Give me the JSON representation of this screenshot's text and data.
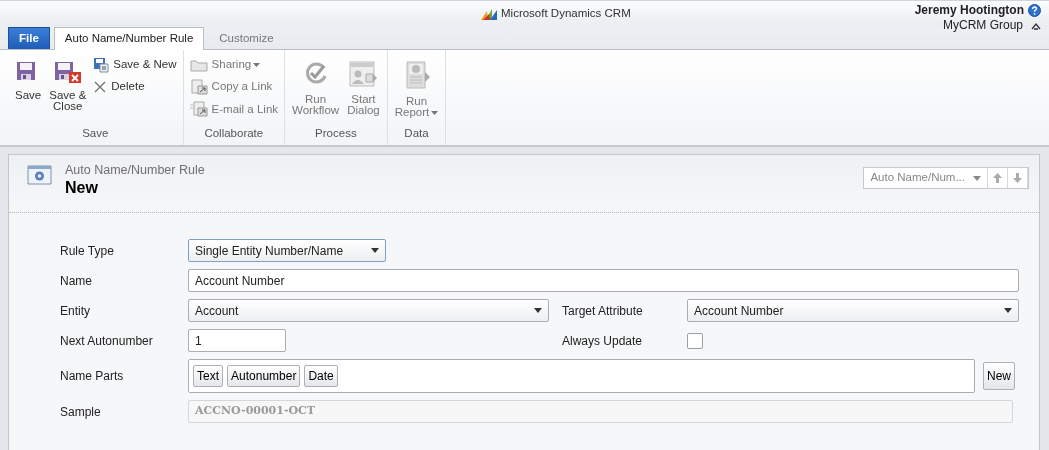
{
  "app": {
    "title": "Microsoft Dynamics CRM",
    "user": "Jeremy Hootington",
    "organization": "MyCRM Group"
  },
  "tabs": [
    {
      "label": "File",
      "kind": "file",
      "selected": false
    },
    {
      "label": "Auto Name/Number Rule",
      "kind": "tab",
      "selected": true
    },
    {
      "label": "Customize",
      "kind": "tab",
      "selected": false
    }
  ],
  "ribbon": [
    {
      "label": "Save",
      "items": [
        {
          "label": "Save",
          "kind": "large",
          "disabled": false,
          "dropdown": false
        },
        {
          "label": "Save &\nClose",
          "kind": "large",
          "disabled": false,
          "dropdown": false
        },
        {
          "label": "Save & New",
          "kind": "small",
          "disabled": false,
          "dropdown": false
        },
        {
          "label": "Delete",
          "kind": "small",
          "disabled": false,
          "dropdown": false
        }
      ]
    },
    {
      "label": "Collaborate",
      "items": [
        {
          "label": "Sharing",
          "kind": "small",
          "disabled": true,
          "dropdown": true
        },
        {
          "label": "Copy a Link",
          "kind": "small",
          "disabled": true,
          "dropdown": false
        },
        {
          "label": "E-mail a Link",
          "kind": "small",
          "disabled": true,
          "dropdown": false
        }
      ]
    },
    {
      "label": "Process",
      "items": [
        {
          "label": "Run\nWorkflow",
          "kind": "large",
          "disabled": true,
          "dropdown": false
        },
        {
          "label": "Start\nDialog",
          "kind": "large",
          "disabled": true,
          "dropdown": false
        }
      ]
    },
    {
      "label": "Data",
      "items": [
        {
          "label": "Run\nReport",
          "kind": "large",
          "disabled": true,
          "dropdown": true
        }
      ]
    }
  ],
  "record": {
    "entity_type": "Auto Name/Number Rule",
    "title": "New",
    "navigator": "Auto Name/Num..."
  },
  "form": [
    {
      "fields": [
        {
          "label": "Rule Type",
          "kind": "select",
          "value": "Single Entity Number/Name"
        }
      ]
    },
    {
      "fields": [
        {
          "label": "Name",
          "kind": "text",
          "value": "Account Number"
        }
      ]
    },
    {
      "fields": [
        {
          "label": "Entity",
          "kind": "select",
          "value": "Account"
        },
        {
          "label": "Target Attribute",
          "kind": "select",
          "value": "Account Number"
        }
      ]
    },
    {
      "fields": [
        {
          "label": "Next Autonumber",
          "kind": "text",
          "value": "1"
        },
        {
          "label": "Always Update",
          "kind": "checkbox",
          "checked": false
        }
      ]
    },
    {
      "fields": [
        {
          "label": "Name Parts",
          "kind": "parts",
          "parts": [
            "Text",
            "Autonumber",
            "Date"
          ],
          "action": "New"
        }
      ]
    },
    {
      "fields": [
        {
          "label": "Sample",
          "kind": "readonly",
          "value": "ACCNO-00001-OCT"
        }
      ]
    }
  ]
}
